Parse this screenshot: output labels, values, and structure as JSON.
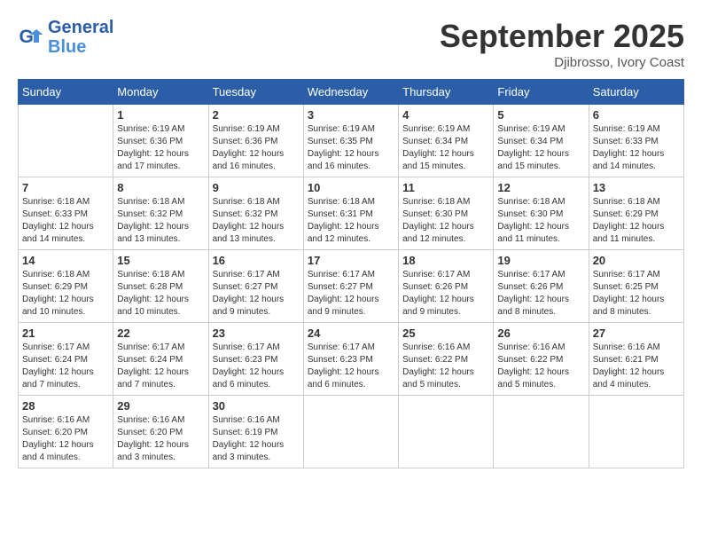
{
  "header": {
    "logo_line1": "General",
    "logo_line2": "Blue",
    "month_title": "September 2025",
    "location": "Djibrosso, Ivory Coast"
  },
  "weekdays": [
    "Sunday",
    "Monday",
    "Tuesday",
    "Wednesday",
    "Thursday",
    "Friday",
    "Saturday"
  ],
  "weeks": [
    [
      {
        "day": "",
        "info": ""
      },
      {
        "day": "1",
        "info": "Sunrise: 6:19 AM\nSunset: 6:36 PM\nDaylight: 12 hours\nand 17 minutes."
      },
      {
        "day": "2",
        "info": "Sunrise: 6:19 AM\nSunset: 6:36 PM\nDaylight: 12 hours\nand 16 minutes."
      },
      {
        "day": "3",
        "info": "Sunrise: 6:19 AM\nSunset: 6:35 PM\nDaylight: 12 hours\nand 16 minutes."
      },
      {
        "day": "4",
        "info": "Sunrise: 6:19 AM\nSunset: 6:34 PM\nDaylight: 12 hours\nand 15 minutes."
      },
      {
        "day": "5",
        "info": "Sunrise: 6:19 AM\nSunset: 6:34 PM\nDaylight: 12 hours\nand 15 minutes."
      },
      {
        "day": "6",
        "info": "Sunrise: 6:19 AM\nSunset: 6:33 PM\nDaylight: 12 hours\nand 14 minutes."
      }
    ],
    [
      {
        "day": "7",
        "info": "Sunrise: 6:18 AM\nSunset: 6:33 PM\nDaylight: 12 hours\nand 14 minutes."
      },
      {
        "day": "8",
        "info": "Sunrise: 6:18 AM\nSunset: 6:32 PM\nDaylight: 12 hours\nand 13 minutes."
      },
      {
        "day": "9",
        "info": "Sunrise: 6:18 AM\nSunset: 6:32 PM\nDaylight: 12 hours\nand 13 minutes."
      },
      {
        "day": "10",
        "info": "Sunrise: 6:18 AM\nSunset: 6:31 PM\nDaylight: 12 hours\nand 12 minutes."
      },
      {
        "day": "11",
        "info": "Sunrise: 6:18 AM\nSunset: 6:30 PM\nDaylight: 12 hours\nand 12 minutes."
      },
      {
        "day": "12",
        "info": "Sunrise: 6:18 AM\nSunset: 6:30 PM\nDaylight: 12 hours\nand 11 minutes."
      },
      {
        "day": "13",
        "info": "Sunrise: 6:18 AM\nSunset: 6:29 PM\nDaylight: 12 hours\nand 11 minutes."
      }
    ],
    [
      {
        "day": "14",
        "info": "Sunrise: 6:18 AM\nSunset: 6:29 PM\nDaylight: 12 hours\nand 10 minutes."
      },
      {
        "day": "15",
        "info": "Sunrise: 6:18 AM\nSunset: 6:28 PM\nDaylight: 12 hours\nand 10 minutes."
      },
      {
        "day": "16",
        "info": "Sunrise: 6:17 AM\nSunset: 6:27 PM\nDaylight: 12 hours\nand 9 minutes."
      },
      {
        "day": "17",
        "info": "Sunrise: 6:17 AM\nSunset: 6:27 PM\nDaylight: 12 hours\nand 9 minutes."
      },
      {
        "day": "18",
        "info": "Sunrise: 6:17 AM\nSunset: 6:26 PM\nDaylight: 12 hours\nand 9 minutes."
      },
      {
        "day": "19",
        "info": "Sunrise: 6:17 AM\nSunset: 6:26 PM\nDaylight: 12 hours\nand 8 minutes."
      },
      {
        "day": "20",
        "info": "Sunrise: 6:17 AM\nSunset: 6:25 PM\nDaylight: 12 hours\nand 8 minutes."
      }
    ],
    [
      {
        "day": "21",
        "info": "Sunrise: 6:17 AM\nSunset: 6:24 PM\nDaylight: 12 hours\nand 7 minutes."
      },
      {
        "day": "22",
        "info": "Sunrise: 6:17 AM\nSunset: 6:24 PM\nDaylight: 12 hours\nand 7 minutes."
      },
      {
        "day": "23",
        "info": "Sunrise: 6:17 AM\nSunset: 6:23 PM\nDaylight: 12 hours\nand 6 minutes."
      },
      {
        "day": "24",
        "info": "Sunrise: 6:17 AM\nSunset: 6:23 PM\nDaylight: 12 hours\nand 6 minutes."
      },
      {
        "day": "25",
        "info": "Sunrise: 6:16 AM\nSunset: 6:22 PM\nDaylight: 12 hours\nand 5 minutes."
      },
      {
        "day": "26",
        "info": "Sunrise: 6:16 AM\nSunset: 6:22 PM\nDaylight: 12 hours\nand 5 minutes."
      },
      {
        "day": "27",
        "info": "Sunrise: 6:16 AM\nSunset: 6:21 PM\nDaylight: 12 hours\nand 4 minutes."
      }
    ],
    [
      {
        "day": "28",
        "info": "Sunrise: 6:16 AM\nSunset: 6:20 PM\nDaylight: 12 hours\nand 4 minutes."
      },
      {
        "day": "29",
        "info": "Sunrise: 6:16 AM\nSunset: 6:20 PM\nDaylight: 12 hours\nand 3 minutes."
      },
      {
        "day": "30",
        "info": "Sunrise: 6:16 AM\nSunset: 6:19 PM\nDaylight: 12 hours\nand 3 minutes."
      },
      {
        "day": "",
        "info": ""
      },
      {
        "day": "",
        "info": ""
      },
      {
        "day": "",
        "info": ""
      },
      {
        "day": "",
        "info": ""
      }
    ]
  ]
}
